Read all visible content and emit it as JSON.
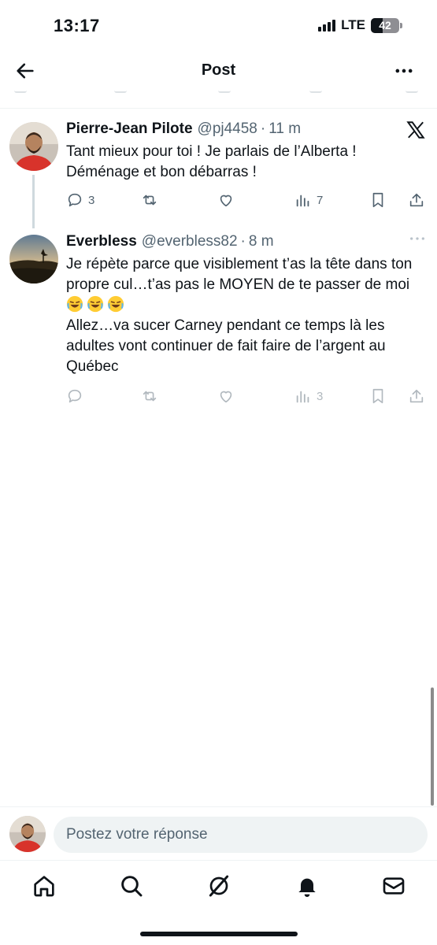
{
  "status_bar": {
    "time": "13:17",
    "network": "LTE",
    "battery": "42",
    "battery_level": 0.42
  },
  "header": {
    "title": "Post"
  },
  "tweets": [
    {
      "author": "Pierre-Jean Pilote",
      "handle": "@pj4458",
      "time": "11 m",
      "text": [
        "Tant mieux pour toi ! Je parlais de l’Alberta !",
        "Déménage et bon débarras !"
      ],
      "replies": "3",
      "reposts": "",
      "likes": "",
      "views": "7"
    },
    {
      "author": "Everbless",
      "handle": "@everbless82",
      "time": "8 m",
      "text": [
        "Je répète parce que visiblement t’as la tête dans ton propre cul…t’as pas le MOYEN de te passer de moi",
        "Allez…va sucer Carney pendant ce temps là les adultes vont continuer de fait faire de l’argent au Québec"
      ],
      "replies": "",
      "reposts": "",
      "likes": "",
      "views": "3"
    }
  ],
  "reply": {
    "placeholder": "Postez votre réponse"
  },
  "icons": {
    "back": "arrow-left-icon",
    "more": "more-horizontal-icon",
    "x_logo": "x-logo-icon",
    "reply": "comment-icon",
    "repost": "repost-icon",
    "like": "heart-icon",
    "views": "bar-chart-icon",
    "bookmark": "bookmark-icon",
    "share": "share-icon",
    "tabs": [
      "home-icon",
      "search-icon",
      "grok-icon",
      "bell-icon",
      "mail-icon"
    ]
  },
  "colors": {
    "text": "#0f1419",
    "secondary": "#536471",
    "divider": "#eff3f4"
  }
}
